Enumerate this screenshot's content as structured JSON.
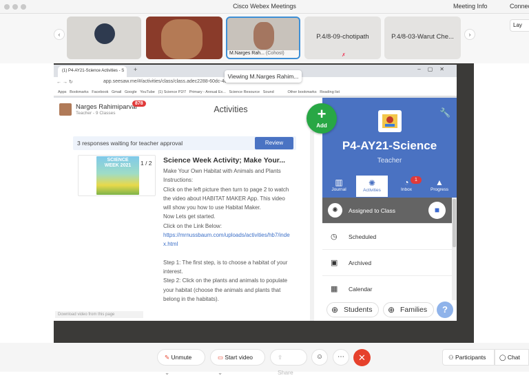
{
  "webex": {
    "title": "Cisco Webex Meetings",
    "meeting_info": "Meeting Info",
    "connect": "Connec",
    "layout": "Lay",
    "participants": [
      {
        "label": ""
      },
      {
        "label": ""
      },
      {
        "label": "M.Narges Rah...",
        "role": "(Cohost)"
      },
      {
        "label": "P.4/8-09-chotipath"
      },
      {
        "label": "P.4/8-03-Warut Che..."
      }
    ],
    "viewing": "Viewing M.Narges Rahim...",
    "controls": {
      "unmute": "Unmute",
      "start_video": "Start video",
      "share": "Share",
      "participants": "Participants",
      "chat": "Chat"
    }
  },
  "browser": {
    "tab": "(1) P4-AY21-Science Activities - S",
    "url": "app.seesaw.me/#/activities/class/class.adec2288-60dc-4089-b32...",
    "bookmarks": [
      "Apps",
      "Bookmarks",
      "Facebook",
      "Gmail",
      "Google",
      "YouTube",
      "(1) Science P2/7",
      "Primary - Annual Ex...",
      "Science Resource",
      "Sound",
      "Other bookmarks",
      "Reading list"
    ]
  },
  "seesaw": {
    "user_name": "Narges Rahimiparvar",
    "user_role": "Teacher - 9 Classes",
    "notification_count": "878",
    "page_title": "Activities",
    "approval_text": "3 responses waiting for teacher approval",
    "review_label": "Review",
    "poster_text": "SCIENCE WEEK 2021",
    "pager": "1 / 2",
    "post_title": "Science Week Activity; Make Your...",
    "post_lines": [
      "Make Your Own Habitat with Animals and Plants",
      "Instructions:",
      "Click on the left picture then turn to page 2 to watch the video about HABITAT MAKER App. This video will show you how to use Habitat Maker.",
      "Now Lets get started.",
      "Click on the Link Below:"
    ],
    "post_link": "https://mrnussbaum.com/uploads/activities/hb7/index.html",
    "post_steps": [
      "Step 1: The first step, is to choose a habitat of your interest.",
      "Step 2: Click on the plants and animals to populate your habitat (choose the animals and plants that belong in the habitats)."
    ],
    "download_label": "Download video from this page",
    "add_label": "Add",
    "class_title": "P4-AY21-Science",
    "class_sub": "Teacher",
    "tabs": [
      "Journal",
      "Activities",
      "Inbox",
      "Progress"
    ],
    "inbox_count": "1",
    "rows": [
      "Assigned to Class",
      "Scheduled",
      "Archived",
      "Calendar"
    ],
    "students_label": "Students",
    "families_label": "Families",
    "help": "?"
  },
  "colors": {
    "seesaw_blue": "#4a72c2",
    "add_green": "#28a745",
    "leave_red": "#e6412c",
    "badge_red": "#e03a3a"
  }
}
